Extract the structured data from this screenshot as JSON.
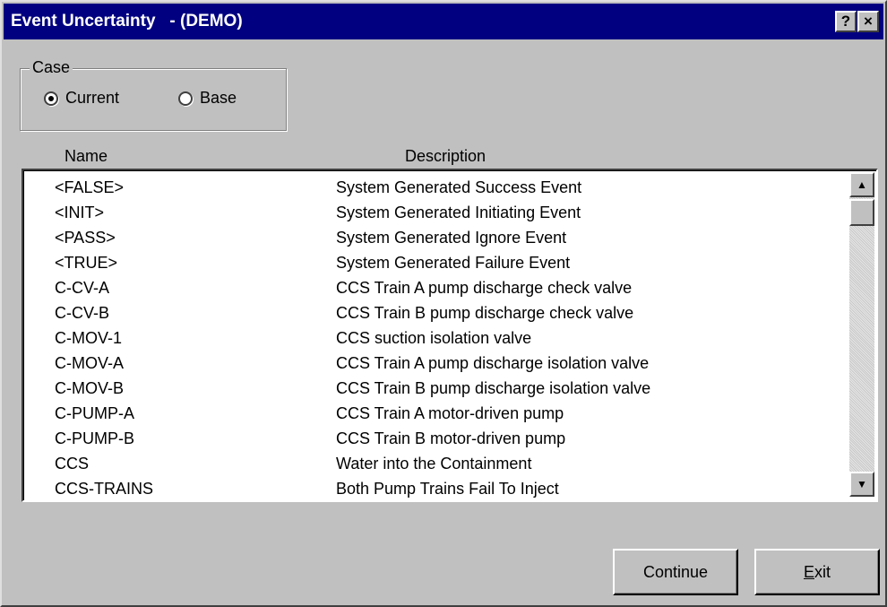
{
  "window": {
    "title": "Event Uncertainty   - (DEMO)",
    "help_button": "?",
    "close_button": "×"
  },
  "case_group": {
    "legend": "Case",
    "options": [
      {
        "label": "Current",
        "selected": true
      },
      {
        "label": "Base",
        "selected": false
      }
    ]
  },
  "table": {
    "columns": [
      "Name",
      "Description"
    ],
    "rows": [
      {
        "name": "<FALSE>",
        "description": "System Generated Success Event"
      },
      {
        "name": "<INIT>",
        "description": "System Generated Initiating Event"
      },
      {
        "name": "<PASS>",
        "description": "System Generated Ignore Event"
      },
      {
        "name": "<TRUE>",
        "description": "System Generated Failure Event"
      },
      {
        "name": "C-CV-A",
        "description": "CCS Train A pump discharge check valve"
      },
      {
        "name": "C-CV-B",
        "description": "CCS Train B pump discharge check valve"
      },
      {
        "name": "C-MOV-1",
        "description": "CCS suction isolation valve"
      },
      {
        "name": "C-MOV-A",
        "description": "CCS Train A pump discharge isolation valve"
      },
      {
        "name": "C-MOV-B",
        "description": "CCS Train B pump discharge isolation valve"
      },
      {
        "name": "C-PUMP-A",
        "description": "CCS Train A motor-driven pump"
      },
      {
        "name": "C-PUMP-B",
        "description": "CCS Train B motor-driven pump"
      },
      {
        "name": "CCS",
        "description": "Water into the Containment"
      },
      {
        "name": "CCS-TRAINS",
        "description": "Both Pump Trains Fail To Inject"
      }
    ]
  },
  "buttons": {
    "continue": "Continue",
    "exit_mnemonic": "E",
    "exit_rest": "xit"
  },
  "colors": {
    "titlebar": "#000080",
    "face": "#c0c0c0"
  }
}
